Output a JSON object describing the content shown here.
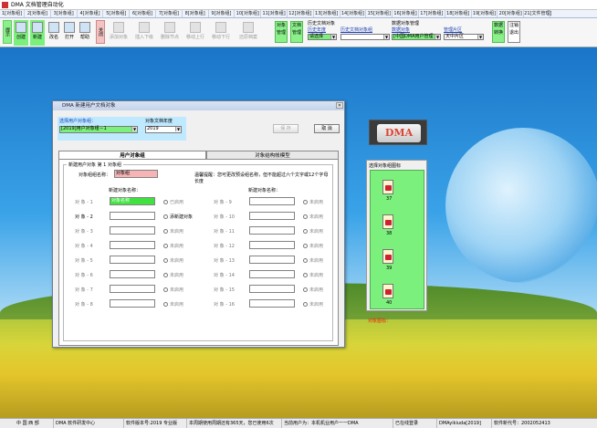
{
  "window": {
    "title": "DMA 文档管理自动化"
  },
  "tabs": [
    "1[对象组]",
    "2[对象组]",
    "3[对象组]",
    "4[对象组]",
    "5[对象组]",
    "6[对象组]",
    "7[对象组]",
    "8[对象组]",
    "9[对象组]",
    "10[对象组]",
    "11[对象组]",
    "12[对象组]",
    "13[对象组]",
    "14[对象组]",
    "15[对象组]",
    "16[对象组]",
    "17[对象组]",
    "18[对象组]",
    "19[对象组]",
    "20[对象组]",
    "21[文件管理]"
  ],
  "toolbar": {
    "side_label": "提示",
    "buttons": [
      "创建",
      "新建",
      "改名",
      "打开",
      "帮助"
    ],
    "close_label": "关闭",
    "disabled_buttons": [
      "添加对象",
      "插入下级",
      "删除节点",
      "移动上行",
      "移动下行",
      "还原档案"
    ],
    "object_btn": "对象管理",
    "doc_btn": "文档管理",
    "history_group": {
      "title": "历史文档对象",
      "year_label": "历史年度",
      "year_value": "请选择",
      "obj_label": "历史文档对象组",
      "obj_value": ""
    },
    "data_group": {
      "title": "数据对象管理",
      "obj_label": "数据对象",
      "obj_value": "[中国DMA用户管理",
      "region_label": "管理片区",
      "region_value": "天中片区"
    },
    "switch_btn": "数据转换",
    "exit_btn": "注销退出"
  },
  "dialog": {
    "title": "DMA 新建用户文档对象",
    "user_group_label": "选择用户对象组：",
    "user_group_value": "[2019]用户对象组－1",
    "year_label": "对象文档年度",
    "year_value": "2019",
    "save_btn": "保  存",
    "cancel_btn": "取  消",
    "tab_user": "用户对象组",
    "tab_struct": "对象结构帐模型",
    "group_legend": "新建用户对象 第 1 对象组",
    "group_name_label": "对象组组名称：",
    "group_name_value": "对象组",
    "hint": "温馨提醒：您可更改预设组名称，但不能超过六个文字或12个字母长度",
    "left_col_header": "新建对象名称：",
    "right_col_header": "新建对象名称：",
    "left_rows": [
      {
        "label": "对  象 - 1",
        "value": "对象名称",
        "radio": "已启用"
      },
      {
        "label": "对  象 - 2",
        "value": "",
        "radio": "添新建对象"
      },
      {
        "label": "对  象 - 3",
        "value": "",
        "radio": "未启用"
      },
      {
        "label": "对  象 - 4",
        "value": "",
        "radio": "未启用"
      },
      {
        "label": "对  象 - 5",
        "value": "",
        "radio": "未启用"
      },
      {
        "label": "对  象 - 6",
        "value": "",
        "radio": "未启用"
      },
      {
        "label": "对  象 - 7",
        "value": "",
        "radio": "未启用"
      },
      {
        "label": "对  象 - 8",
        "value": "",
        "radio": "未启用"
      }
    ],
    "right_rows": [
      {
        "label": "对  象 - 9",
        "value": "",
        "radio": "未启用"
      },
      {
        "label": "对  象 - 10",
        "value": "",
        "radio": "未启用"
      },
      {
        "label": "对  象 - 11",
        "value": "",
        "radio": "未启用"
      },
      {
        "label": "对  象 - 12",
        "value": "",
        "radio": "未启用"
      },
      {
        "label": "对  象 - 13",
        "value": "",
        "radio": "未启用"
      },
      {
        "label": "对  象 - 14",
        "value": "",
        "radio": "未启用"
      },
      {
        "label": "对  象 - 15",
        "value": "",
        "radio": "未启用"
      },
      {
        "label": "对  象 - 16",
        "value": "",
        "radio": "未启用"
      }
    ]
  },
  "right_panel": {
    "logo_text": "DMA",
    "icon_group_label": "选择对象组图标",
    "icons": [
      "37",
      "38",
      "39",
      "40"
    ],
    "icon_label": "对象图标："
  },
  "statusbar": {
    "start": "中  国  西  部",
    "center": "DMA 软件研发中心",
    "version": "软件版本号:2019 专业版",
    "days": "本周期使用周期还有365天，您已使用6次",
    "user": "当前用户为：本机机业用户一一DMA",
    "login": "已在线登录",
    "code": "DMAyikiuda[2019]",
    "serial": "软件新代号：2002052413"
  },
  "colors": {
    "accent_green": "#7cf07c",
    "input_green": "#3fe23f",
    "input_pink": "#f7b4b4",
    "light_blue": "#bfe9ff"
  }
}
